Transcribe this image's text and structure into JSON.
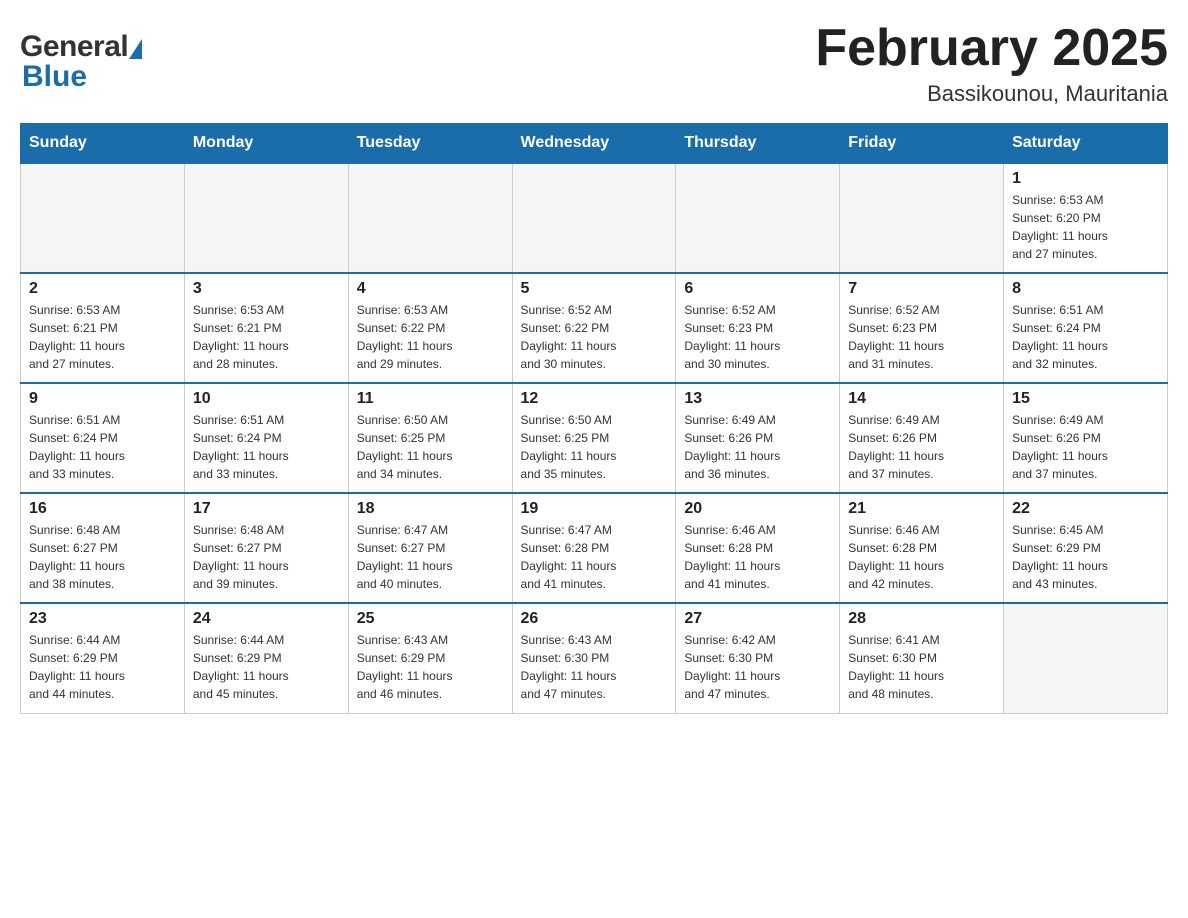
{
  "header": {
    "month_year": "February 2025",
    "location": "Bassikounou, Mauritania"
  },
  "logo": {
    "general": "General",
    "blue": "Blue"
  },
  "weekdays": [
    "Sunday",
    "Monday",
    "Tuesday",
    "Wednesday",
    "Thursday",
    "Friday",
    "Saturday"
  ],
  "weeks": [
    [
      {
        "day": "",
        "info": ""
      },
      {
        "day": "",
        "info": ""
      },
      {
        "day": "",
        "info": ""
      },
      {
        "day": "",
        "info": ""
      },
      {
        "day": "",
        "info": ""
      },
      {
        "day": "",
        "info": ""
      },
      {
        "day": "1",
        "info": "Sunrise: 6:53 AM\nSunset: 6:20 PM\nDaylight: 11 hours\nand 27 minutes."
      }
    ],
    [
      {
        "day": "2",
        "info": "Sunrise: 6:53 AM\nSunset: 6:21 PM\nDaylight: 11 hours\nand 27 minutes."
      },
      {
        "day": "3",
        "info": "Sunrise: 6:53 AM\nSunset: 6:21 PM\nDaylight: 11 hours\nand 28 minutes."
      },
      {
        "day": "4",
        "info": "Sunrise: 6:53 AM\nSunset: 6:22 PM\nDaylight: 11 hours\nand 29 minutes."
      },
      {
        "day": "5",
        "info": "Sunrise: 6:52 AM\nSunset: 6:22 PM\nDaylight: 11 hours\nand 30 minutes."
      },
      {
        "day": "6",
        "info": "Sunrise: 6:52 AM\nSunset: 6:23 PM\nDaylight: 11 hours\nand 30 minutes."
      },
      {
        "day": "7",
        "info": "Sunrise: 6:52 AM\nSunset: 6:23 PM\nDaylight: 11 hours\nand 31 minutes."
      },
      {
        "day": "8",
        "info": "Sunrise: 6:51 AM\nSunset: 6:24 PM\nDaylight: 11 hours\nand 32 minutes."
      }
    ],
    [
      {
        "day": "9",
        "info": "Sunrise: 6:51 AM\nSunset: 6:24 PM\nDaylight: 11 hours\nand 33 minutes."
      },
      {
        "day": "10",
        "info": "Sunrise: 6:51 AM\nSunset: 6:24 PM\nDaylight: 11 hours\nand 33 minutes."
      },
      {
        "day": "11",
        "info": "Sunrise: 6:50 AM\nSunset: 6:25 PM\nDaylight: 11 hours\nand 34 minutes."
      },
      {
        "day": "12",
        "info": "Sunrise: 6:50 AM\nSunset: 6:25 PM\nDaylight: 11 hours\nand 35 minutes."
      },
      {
        "day": "13",
        "info": "Sunrise: 6:49 AM\nSunset: 6:26 PM\nDaylight: 11 hours\nand 36 minutes."
      },
      {
        "day": "14",
        "info": "Sunrise: 6:49 AM\nSunset: 6:26 PM\nDaylight: 11 hours\nand 37 minutes."
      },
      {
        "day": "15",
        "info": "Sunrise: 6:49 AM\nSunset: 6:26 PM\nDaylight: 11 hours\nand 37 minutes."
      }
    ],
    [
      {
        "day": "16",
        "info": "Sunrise: 6:48 AM\nSunset: 6:27 PM\nDaylight: 11 hours\nand 38 minutes."
      },
      {
        "day": "17",
        "info": "Sunrise: 6:48 AM\nSunset: 6:27 PM\nDaylight: 11 hours\nand 39 minutes."
      },
      {
        "day": "18",
        "info": "Sunrise: 6:47 AM\nSunset: 6:27 PM\nDaylight: 11 hours\nand 40 minutes."
      },
      {
        "day": "19",
        "info": "Sunrise: 6:47 AM\nSunset: 6:28 PM\nDaylight: 11 hours\nand 41 minutes."
      },
      {
        "day": "20",
        "info": "Sunrise: 6:46 AM\nSunset: 6:28 PM\nDaylight: 11 hours\nand 41 minutes."
      },
      {
        "day": "21",
        "info": "Sunrise: 6:46 AM\nSunset: 6:28 PM\nDaylight: 11 hours\nand 42 minutes."
      },
      {
        "day": "22",
        "info": "Sunrise: 6:45 AM\nSunset: 6:29 PM\nDaylight: 11 hours\nand 43 minutes."
      }
    ],
    [
      {
        "day": "23",
        "info": "Sunrise: 6:44 AM\nSunset: 6:29 PM\nDaylight: 11 hours\nand 44 minutes."
      },
      {
        "day": "24",
        "info": "Sunrise: 6:44 AM\nSunset: 6:29 PM\nDaylight: 11 hours\nand 45 minutes."
      },
      {
        "day": "25",
        "info": "Sunrise: 6:43 AM\nSunset: 6:29 PM\nDaylight: 11 hours\nand 46 minutes."
      },
      {
        "day": "26",
        "info": "Sunrise: 6:43 AM\nSunset: 6:30 PM\nDaylight: 11 hours\nand 47 minutes."
      },
      {
        "day": "27",
        "info": "Sunrise: 6:42 AM\nSunset: 6:30 PM\nDaylight: 11 hours\nand 47 minutes."
      },
      {
        "day": "28",
        "info": "Sunrise: 6:41 AM\nSunset: 6:30 PM\nDaylight: 11 hours\nand 48 minutes."
      },
      {
        "day": "",
        "info": ""
      }
    ]
  ]
}
